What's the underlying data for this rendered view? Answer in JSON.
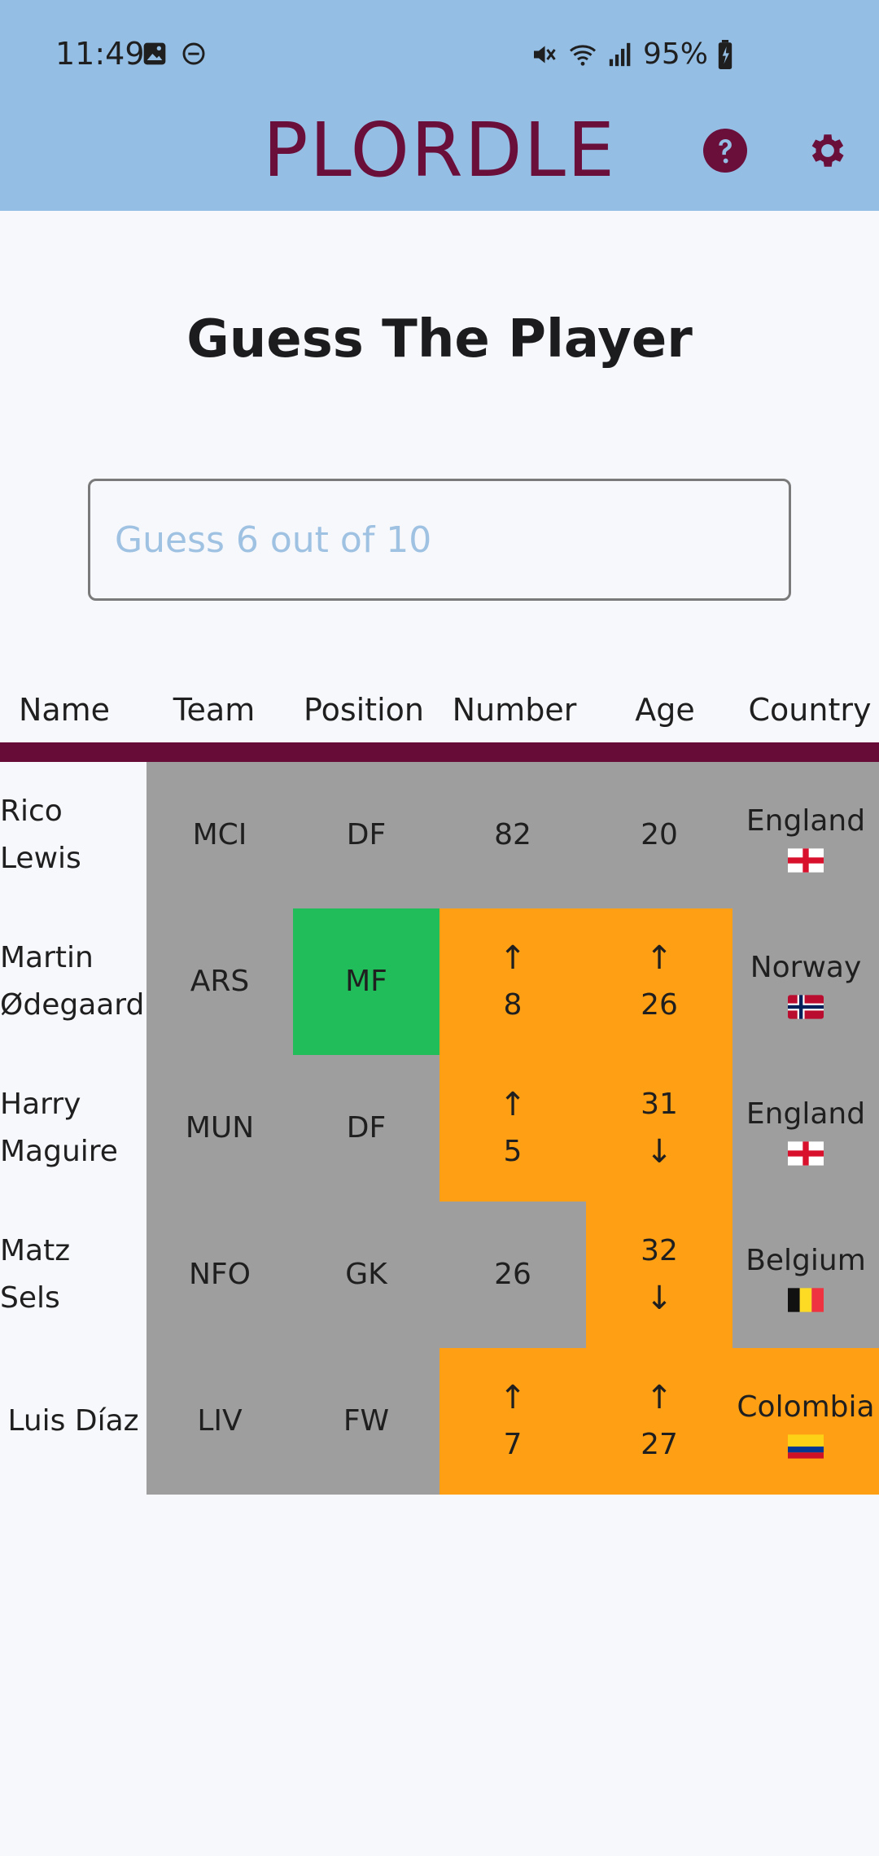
{
  "status": {
    "time": "11:49",
    "battery": "95%"
  },
  "app": {
    "title": "PLORDLE"
  },
  "heading": "Guess The Player",
  "input": {
    "placeholder": "Guess 6 out of 10",
    "value": ""
  },
  "table": {
    "headers": [
      "Name",
      "Team",
      "Position",
      "Number",
      "Age",
      "Country"
    ],
    "rows": [
      {
        "name_line1": "Rico",
        "name_line2": "Lewis",
        "team": "MCI",
        "position": "DF",
        "number": "82",
        "number_arrow": "",
        "age": "20",
        "age_arrow": "",
        "country": "England",
        "colors": {
          "team": "grey",
          "position": "grey",
          "number": "grey",
          "age": "grey",
          "country": "grey"
        }
      },
      {
        "name_line1": "Martin",
        "name_line2": "Ødegaard",
        "team": "ARS",
        "position": "MF",
        "number": "8",
        "number_arrow": "↑",
        "age": "26",
        "age_arrow": "↑",
        "country": "Norway",
        "colors": {
          "team": "grey",
          "position": "green",
          "number": "orange",
          "age": "orange",
          "country": "grey"
        }
      },
      {
        "name_line1": "Harry",
        "name_line2": "Maguire",
        "team": "MUN",
        "position": "DF",
        "number": "5",
        "number_arrow": "↑",
        "age": "31",
        "age_arrow": "↓",
        "country": "England",
        "colors": {
          "team": "grey",
          "position": "grey",
          "number": "orange",
          "age": "orange",
          "country": "grey"
        }
      },
      {
        "name_line1": "Matz",
        "name_line2": "Sels",
        "team": "NFO",
        "position": "GK",
        "number": "26",
        "number_arrow": "",
        "age": "32",
        "age_arrow": "↓",
        "country": "Belgium",
        "colors": {
          "team": "grey",
          "position": "grey",
          "number": "grey",
          "age": "orange",
          "country": "grey"
        }
      },
      {
        "name_line1": "Luis Díaz",
        "name_line2": "",
        "team": "LIV",
        "position": "FW",
        "number": "7",
        "number_arrow": "↑",
        "age": "27",
        "age_arrow": "↑",
        "country": "Colombia",
        "colors": {
          "team": "grey",
          "position": "grey",
          "number": "orange",
          "age": "orange",
          "country": "orange"
        }
      }
    ]
  },
  "colors": {
    "grey": "#9e9e9e",
    "green": "#22bd5b",
    "orange": "#ff9f14",
    "accent": "#660c36",
    "header": "#95bee4"
  }
}
